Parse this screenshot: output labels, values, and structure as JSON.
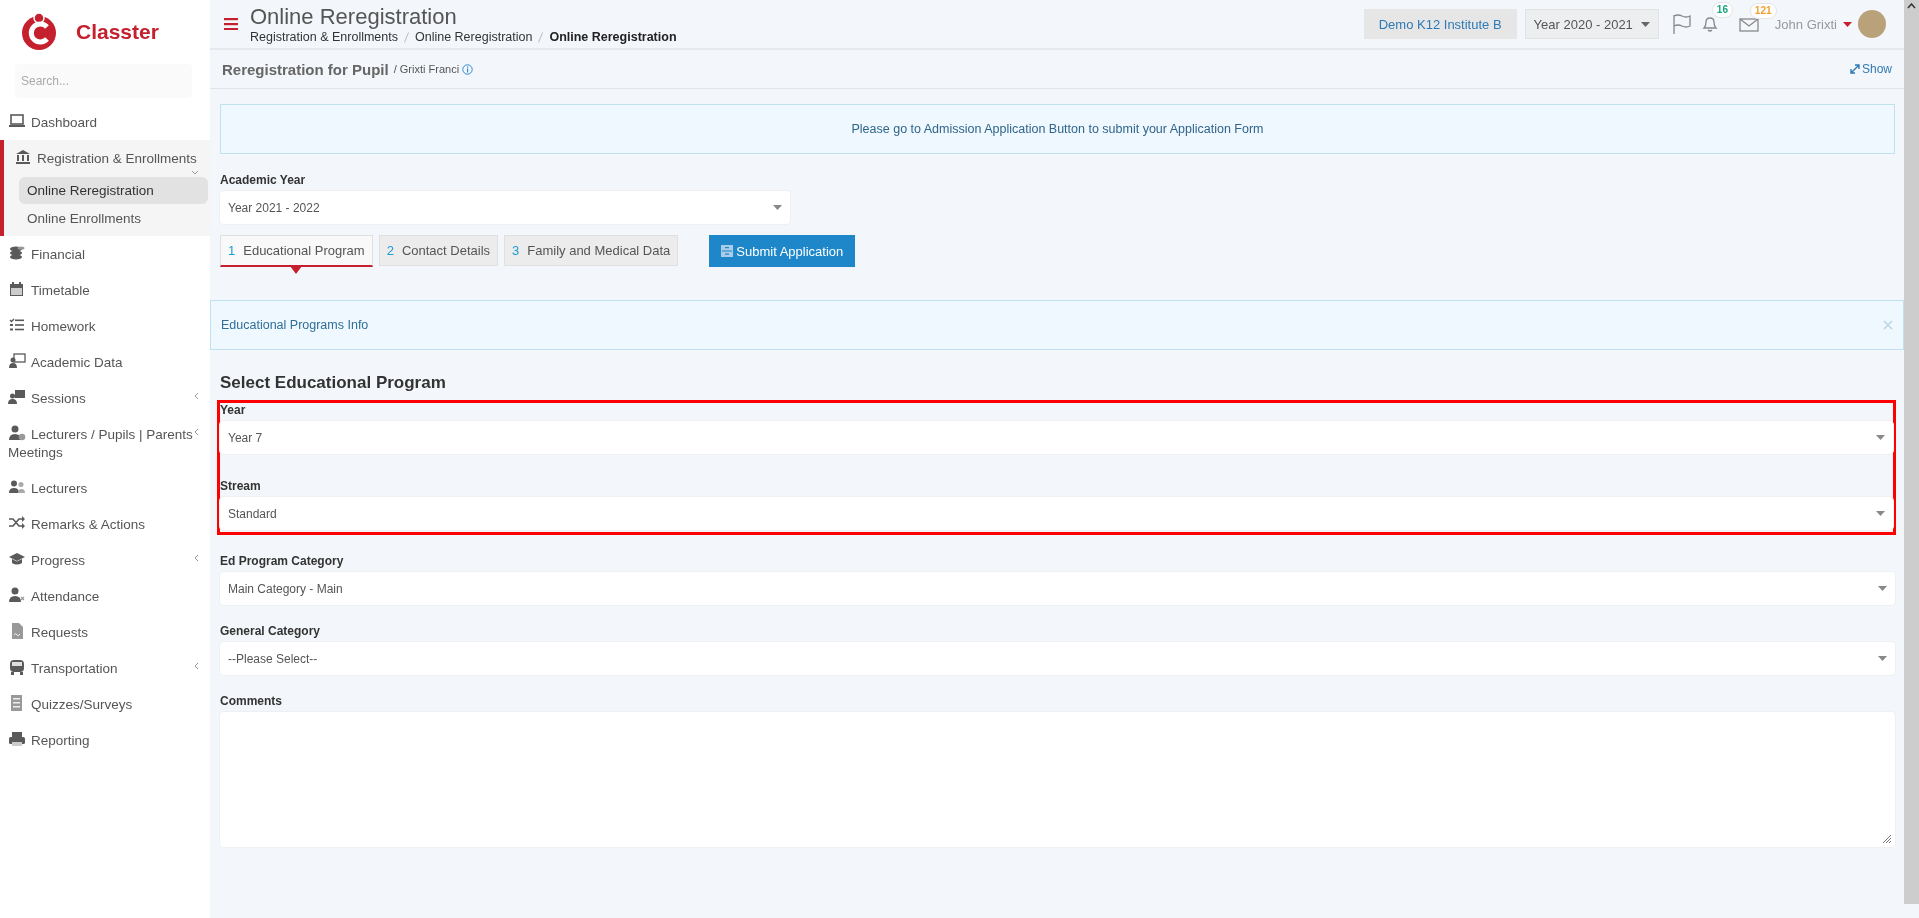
{
  "brand": {
    "name": "Classter"
  },
  "sidebar": {
    "search": {
      "placeholder": "Search..."
    },
    "items": [
      {
        "label": "Dashboard",
        "kind": "link",
        "selected": false
      },
      {
        "label": "Registration & Enrollments",
        "kind": "group",
        "expanded": true,
        "selected": true,
        "children": [
          {
            "label": "Online Reregistration",
            "selected": true
          },
          {
            "label": "Online Enrollments",
            "selected": false
          }
        ]
      },
      {
        "label": "Financial",
        "kind": "link",
        "selected": false
      },
      {
        "label": "Timetable",
        "kind": "link",
        "selected": false
      },
      {
        "label": "Homework",
        "kind": "link",
        "selected": false
      },
      {
        "label": "Academic Data",
        "kind": "link",
        "selected": false
      },
      {
        "label": "Sessions",
        "kind": "group",
        "expanded": false,
        "selected": false
      },
      {
        "label": "Lecturers / Pupils | Parents Meetings",
        "kind": "group",
        "expanded": false,
        "selected": false
      },
      {
        "label": "Lecturers",
        "kind": "link",
        "selected": false
      },
      {
        "label": "Remarks & Actions",
        "kind": "link",
        "selected": false
      },
      {
        "label": "Progress",
        "kind": "group",
        "expanded": false,
        "selected": false
      },
      {
        "label": "Attendance",
        "kind": "link",
        "selected": false
      },
      {
        "label": "Requests",
        "kind": "link",
        "selected": false
      },
      {
        "label": "Transportation",
        "kind": "group",
        "expanded": false,
        "selected": false
      },
      {
        "label": "Quizzes/Surveys",
        "kind": "link",
        "selected": false
      },
      {
        "label": "Reporting",
        "kind": "link",
        "selected": false
      }
    ]
  },
  "header": {
    "title": "Online Reregistration",
    "breadcrumb": [
      {
        "label": "Registration & Enrollments",
        "current": false
      },
      {
        "label": "Online Reregistration",
        "current": false
      },
      {
        "label": "Online Reregistration",
        "current": true
      }
    ],
    "institute": "Demo K12 Institute B",
    "year": "Year 2020 - 2021",
    "notifications": "16",
    "messages": "121",
    "user": "John Grixti"
  },
  "panel": {
    "title": "Reregistration for Pupil",
    "subtitle": "/ Grixti Franci",
    "show_link": "Show"
  },
  "alert": {
    "text": "Please go to Admission Application Button to submit your Application Form"
  },
  "academic_year": {
    "label": "Academic Year",
    "value": "Year 2021 - 2022"
  },
  "steps": [
    {
      "number": "1",
      "label": "Educational Program",
      "selected": true
    },
    {
      "number": "2",
      "label": "Contact Details",
      "selected": false
    },
    {
      "number": "3",
      "label": "Family and Medical Data",
      "selected": false
    }
  ],
  "submit_button": {
    "label": "Submit Application"
  },
  "info_bar": {
    "text": "Educational Programs Info"
  },
  "section_title": "Select Educational Program",
  "fields": [
    {
      "label": "Year",
      "kind": "select",
      "value": "Year 7",
      "highlighted": true
    },
    {
      "label": "Stream",
      "kind": "select",
      "value": "Standard",
      "highlighted": true
    },
    {
      "label": "Ed Program Category",
      "kind": "select",
      "value": "Main Category - Main",
      "highlighted": false
    },
    {
      "label": "General Category",
      "kind": "select",
      "value": "--Please Select--",
      "highlighted": false
    },
    {
      "label": "Comments",
      "kind": "textarea",
      "highlighted": false
    }
  ]
}
